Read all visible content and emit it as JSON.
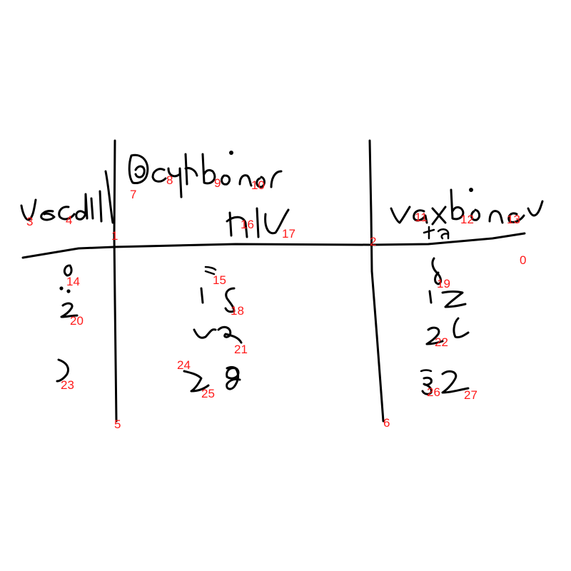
{
  "canvas": {
    "background": "#ffffff",
    "ink_color": "#000000",
    "label_color": "#ff1a1a"
  },
  "labels": [
    "0",
    "1",
    "2",
    "3",
    "4",
    "5",
    "6",
    "7",
    "8",
    "9",
    "10",
    "11",
    "12",
    "13",
    "14",
    "15",
    "16",
    "17",
    "18",
    "19",
    "20",
    "21",
    "22",
    "23",
    "24",
    "25",
    "26",
    "27"
  ]
}
